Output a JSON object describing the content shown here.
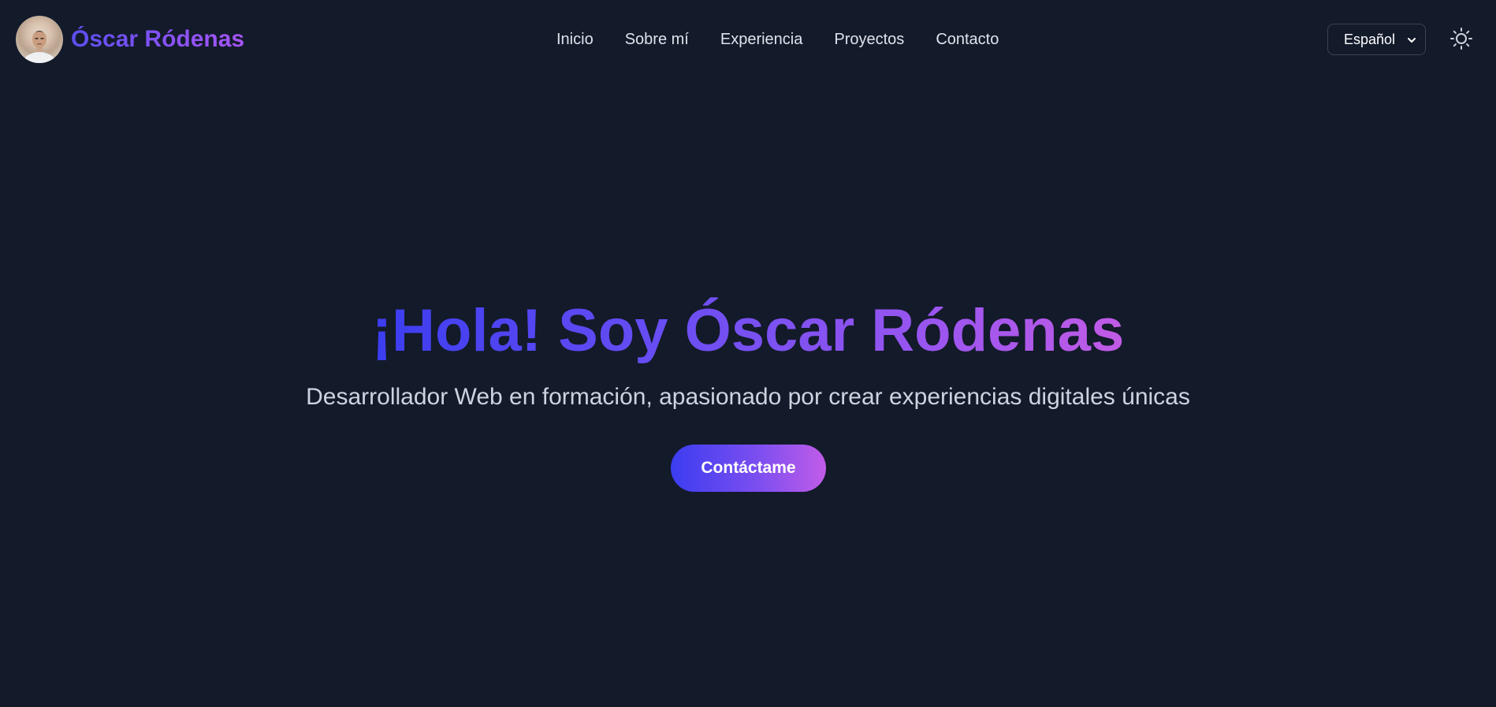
{
  "header": {
    "brand_name": "Óscar Ródenas",
    "nav": [
      {
        "label": "Inicio"
      },
      {
        "label": "Sobre mí"
      },
      {
        "label": "Experiencia"
      },
      {
        "label": "Proyectos"
      },
      {
        "label": "Contacto"
      }
    ],
    "language_select": {
      "selected": "Español"
    },
    "theme_toggle_icon": "sun-icon"
  },
  "hero": {
    "title": "¡Hola! Soy Óscar Ródenas",
    "subtitle": "Desarrollador Web en formación, apasionado por crear experiencias digitales únicas",
    "cta_label": "Contáctame"
  },
  "colors": {
    "background": "#131a2a",
    "gradient_start": "#3b3df0",
    "gradient_end": "#c25be6",
    "nav_text": "#dfe3ec",
    "subtitle_text": "#cdd3df"
  }
}
